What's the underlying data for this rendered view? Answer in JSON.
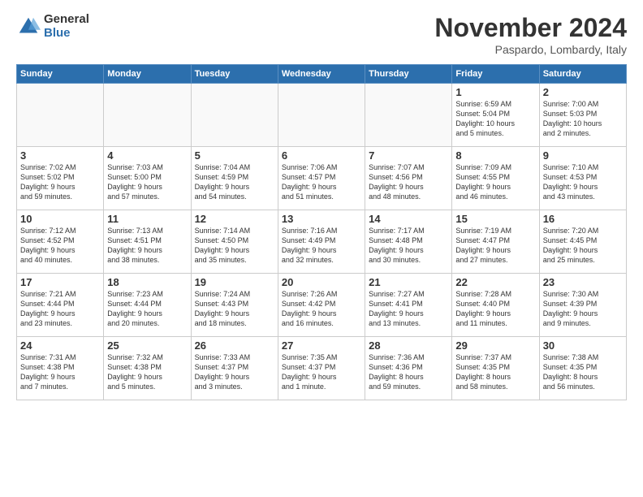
{
  "logo": {
    "general": "General",
    "blue": "Blue"
  },
  "title": "November 2024",
  "location": "Paspardo, Lombardy, Italy",
  "days_header": [
    "Sunday",
    "Monday",
    "Tuesday",
    "Wednesday",
    "Thursday",
    "Friday",
    "Saturday"
  ],
  "weeks": [
    [
      {
        "num": "",
        "info": ""
      },
      {
        "num": "",
        "info": ""
      },
      {
        "num": "",
        "info": ""
      },
      {
        "num": "",
        "info": ""
      },
      {
        "num": "",
        "info": ""
      },
      {
        "num": "1",
        "info": "Sunrise: 6:59 AM\nSunset: 5:04 PM\nDaylight: 10 hours\nand 5 minutes."
      },
      {
        "num": "2",
        "info": "Sunrise: 7:00 AM\nSunset: 5:03 PM\nDaylight: 10 hours\nand 2 minutes."
      }
    ],
    [
      {
        "num": "3",
        "info": "Sunrise: 7:02 AM\nSunset: 5:02 PM\nDaylight: 9 hours\nand 59 minutes."
      },
      {
        "num": "4",
        "info": "Sunrise: 7:03 AM\nSunset: 5:00 PM\nDaylight: 9 hours\nand 57 minutes."
      },
      {
        "num": "5",
        "info": "Sunrise: 7:04 AM\nSunset: 4:59 PM\nDaylight: 9 hours\nand 54 minutes."
      },
      {
        "num": "6",
        "info": "Sunrise: 7:06 AM\nSunset: 4:57 PM\nDaylight: 9 hours\nand 51 minutes."
      },
      {
        "num": "7",
        "info": "Sunrise: 7:07 AM\nSunset: 4:56 PM\nDaylight: 9 hours\nand 48 minutes."
      },
      {
        "num": "8",
        "info": "Sunrise: 7:09 AM\nSunset: 4:55 PM\nDaylight: 9 hours\nand 46 minutes."
      },
      {
        "num": "9",
        "info": "Sunrise: 7:10 AM\nSunset: 4:53 PM\nDaylight: 9 hours\nand 43 minutes."
      }
    ],
    [
      {
        "num": "10",
        "info": "Sunrise: 7:12 AM\nSunset: 4:52 PM\nDaylight: 9 hours\nand 40 minutes."
      },
      {
        "num": "11",
        "info": "Sunrise: 7:13 AM\nSunset: 4:51 PM\nDaylight: 9 hours\nand 38 minutes."
      },
      {
        "num": "12",
        "info": "Sunrise: 7:14 AM\nSunset: 4:50 PM\nDaylight: 9 hours\nand 35 minutes."
      },
      {
        "num": "13",
        "info": "Sunrise: 7:16 AM\nSunset: 4:49 PM\nDaylight: 9 hours\nand 32 minutes."
      },
      {
        "num": "14",
        "info": "Sunrise: 7:17 AM\nSunset: 4:48 PM\nDaylight: 9 hours\nand 30 minutes."
      },
      {
        "num": "15",
        "info": "Sunrise: 7:19 AM\nSunset: 4:47 PM\nDaylight: 9 hours\nand 27 minutes."
      },
      {
        "num": "16",
        "info": "Sunrise: 7:20 AM\nSunset: 4:45 PM\nDaylight: 9 hours\nand 25 minutes."
      }
    ],
    [
      {
        "num": "17",
        "info": "Sunrise: 7:21 AM\nSunset: 4:44 PM\nDaylight: 9 hours\nand 23 minutes."
      },
      {
        "num": "18",
        "info": "Sunrise: 7:23 AM\nSunset: 4:44 PM\nDaylight: 9 hours\nand 20 minutes."
      },
      {
        "num": "19",
        "info": "Sunrise: 7:24 AM\nSunset: 4:43 PM\nDaylight: 9 hours\nand 18 minutes."
      },
      {
        "num": "20",
        "info": "Sunrise: 7:26 AM\nSunset: 4:42 PM\nDaylight: 9 hours\nand 16 minutes."
      },
      {
        "num": "21",
        "info": "Sunrise: 7:27 AM\nSunset: 4:41 PM\nDaylight: 9 hours\nand 13 minutes."
      },
      {
        "num": "22",
        "info": "Sunrise: 7:28 AM\nSunset: 4:40 PM\nDaylight: 9 hours\nand 11 minutes."
      },
      {
        "num": "23",
        "info": "Sunrise: 7:30 AM\nSunset: 4:39 PM\nDaylight: 9 hours\nand 9 minutes."
      }
    ],
    [
      {
        "num": "24",
        "info": "Sunrise: 7:31 AM\nSunset: 4:38 PM\nDaylight: 9 hours\nand 7 minutes."
      },
      {
        "num": "25",
        "info": "Sunrise: 7:32 AM\nSunset: 4:38 PM\nDaylight: 9 hours\nand 5 minutes."
      },
      {
        "num": "26",
        "info": "Sunrise: 7:33 AM\nSunset: 4:37 PM\nDaylight: 9 hours\nand 3 minutes."
      },
      {
        "num": "27",
        "info": "Sunrise: 7:35 AM\nSunset: 4:37 PM\nDaylight: 9 hours\nand 1 minute."
      },
      {
        "num": "28",
        "info": "Sunrise: 7:36 AM\nSunset: 4:36 PM\nDaylight: 8 hours\nand 59 minutes."
      },
      {
        "num": "29",
        "info": "Sunrise: 7:37 AM\nSunset: 4:35 PM\nDaylight: 8 hours\nand 58 minutes."
      },
      {
        "num": "30",
        "info": "Sunrise: 7:38 AM\nSunset: 4:35 PM\nDaylight: 8 hours\nand 56 minutes."
      }
    ]
  ]
}
